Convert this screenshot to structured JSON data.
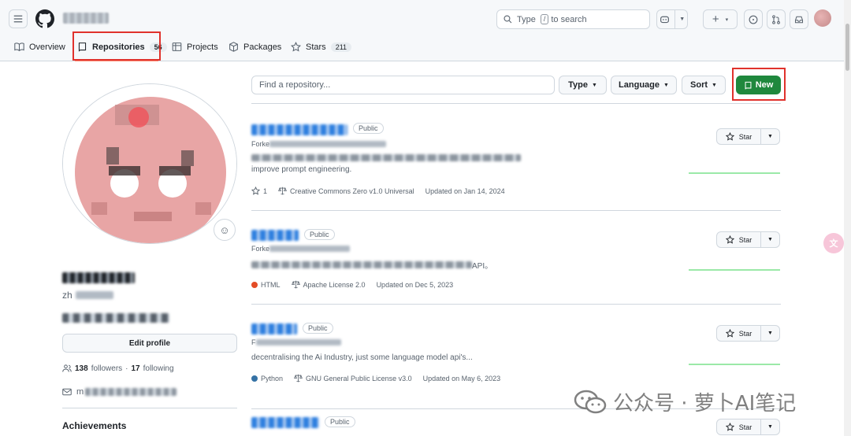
{
  "header": {
    "search_placeholder_pre": "Type",
    "search_key": "/",
    "search_placeholder_post": "to search",
    "plus_caret": "▾"
  },
  "tabs": [
    {
      "label": "Overview"
    },
    {
      "label": "Repositories",
      "count": "56"
    },
    {
      "label": "Projects"
    },
    {
      "label": "Packages"
    },
    {
      "label": "Stars",
      "count": "211"
    }
  ],
  "profile": {
    "edit_label": "Edit profile",
    "followers_count": "138",
    "followers_label": "followers",
    "sep": "·",
    "following_count": "17",
    "following_label": "following",
    "achievements_label": "Achievements",
    "email_prefix": "m",
    "login_prefix": "zh"
  },
  "filters": {
    "find_placeholder": "Find a repository...",
    "type_label": "Type",
    "language_label": "Language",
    "sort_label": "Sort",
    "new_label": "New"
  },
  "repos": [
    {
      "visibility": "Public",
      "forked_prefix": "Forke",
      "desc_line2": "improve prompt engineering.",
      "stars": "1",
      "license": "Creative Commons Zero v1.0 Universal",
      "updated": "Updated on Jan 14, 2024",
      "star_label": "Star"
    },
    {
      "visibility": "Public",
      "forked_prefix": "Forke",
      "desc_line2": "API。",
      "language": "HTML",
      "language_color": "#e34c26",
      "license": "Apache License 2.0",
      "updated": "Updated on Dec 5, 2023",
      "star_label": "Star"
    },
    {
      "visibility": "Public",
      "forked_prefix": "F",
      "desc_line1": "decentralising the Ai Industry, just some language model api's...",
      "language": "Python",
      "language_color": "#3572A5",
      "license": "GNU General Public License v3.0",
      "updated": "Updated on May 6, 2023",
      "star_label": "Star"
    },
    {
      "visibility": "Public",
      "star_label": "Star"
    }
  ],
  "watermark": {
    "text": "公众号 · 萝卜AI笔记"
  },
  "colors": {
    "accent_green": "#1f883d",
    "link_blue": "#0969da",
    "highlight_red": "#e0322c",
    "tab_underline": "#fd8c73"
  },
  "icons": [
    "hamburger-icon",
    "github-logo-icon",
    "search-icon",
    "copilot-icon",
    "plus-icon",
    "issues-icon",
    "pull-request-icon",
    "inbox-icon",
    "book-icon",
    "repo-icon",
    "project-icon",
    "package-icon",
    "star-icon",
    "smiley-icon",
    "people-icon",
    "mail-icon",
    "law-icon",
    "translate-icon",
    "wechat-icon"
  ]
}
